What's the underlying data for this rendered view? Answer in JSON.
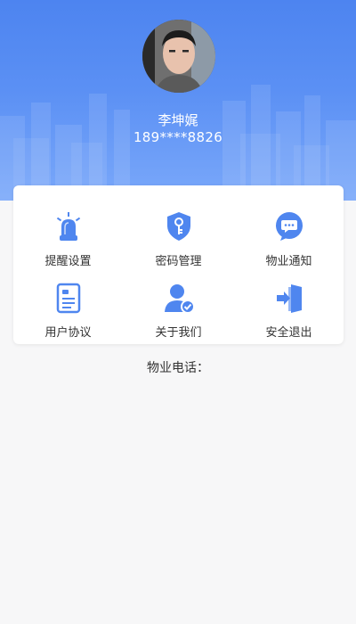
{
  "profile": {
    "name": "李坤娓",
    "phone": "189****8826"
  },
  "menu": {
    "reminder_settings": "提醒设置",
    "password_management": "密码管理",
    "property_notice": "物业通知",
    "user_agreement": "用户协议",
    "about_us": "关于我们",
    "safe_logout": "安全退出"
  },
  "property_phone_label": "物业电话：",
  "colors": {
    "header_blue": "#4d84f0",
    "icon_blue": "#4f86ef"
  }
}
